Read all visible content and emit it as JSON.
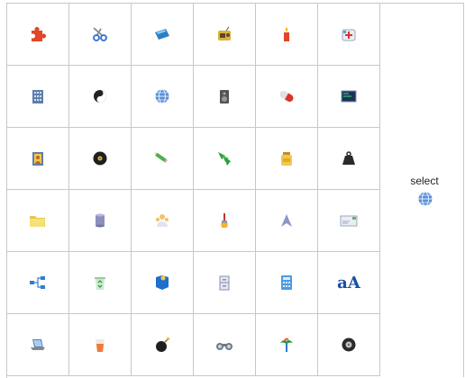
{
  "select_panel": {
    "label": "select",
    "selected_icon": "globe-icon"
  },
  "grid_icons": [
    [
      "puzzle-icon",
      "scissors-icon",
      "scanner-icon",
      "radio-icon",
      "candle-icon",
      "first-aid-kit-icon"
    ],
    [
      "building-icon",
      "yin-yang-icon",
      "globe-icon",
      "speaker-icon",
      "pill-icon",
      "terminal-icon"
    ],
    [
      "portrait-icon",
      "vinyl-record-icon",
      "pencil-icon",
      "bookmark-arrows-icon",
      "honey-jar-icon",
      "weight-icon"
    ],
    [
      "folder-icon",
      "database-icon",
      "user-group-icon",
      "paint-brush-icon",
      "shark-fin-icon",
      "mail-icon"
    ],
    [
      "network-icon",
      "recycle-bin-icon",
      "info-book-icon",
      "filing-cabinet-icon",
      "calculator-icon",
      "font-icon"
    ],
    [
      "laptop-icon",
      "juice-glass-icon",
      "bomb-icon",
      "binoculars-icon",
      "palm-tree-icon",
      "tire-icon"
    ]
  ],
  "font_icon_text": "aA",
  "colors": {
    "grid_line": "#c8c8c8"
  }
}
